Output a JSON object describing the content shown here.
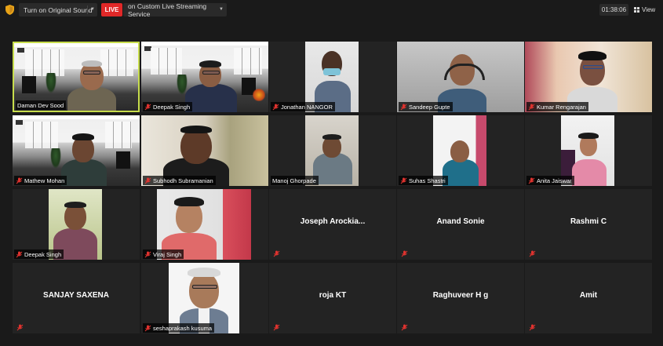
{
  "toolbar": {
    "sound_label": "Turn on Original Sound",
    "live_badge": "LIVE",
    "stream_label": "on Custom Live Streaming Service",
    "timer": "01:38:06",
    "view_label": "View"
  },
  "participants": [
    {
      "name": "Daman Dev Sood",
      "video": true,
      "active": true
    },
    {
      "name": "Deepak Singh",
      "video": true
    },
    {
      "name": "Jonathan NANGOR",
      "video": true
    },
    {
      "name": "Sandeep Gupte",
      "video": true
    },
    {
      "name": "Kumar Rengarajan",
      "video": true
    },
    {
      "name": "Mathew Mohan",
      "video": true
    },
    {
      "name": "Subhodh Subramanian",
      "video": true
    },
    {
      "name": "Manoj Ghorpade",
      "video": true
    },
    {
      "name": "Suhas Shastri",
      "video": true
    },
    {
      "name": "Anita Jaiswar",
      "video": true
    },
    {
      "name": "Deepak Singh",
      "video": true
    },
    {
      "name": "Viraj Singh",
      "video": true
    },
    {
      "name": "Joseph  Arockia...",
      "video": false
    },
    {
      "name": "Anand Sonie",
      "video": false
    },
    {
      "name": "Rashmi C",
      "video": false
    },
    {
      "name": "SANJAY SAXENA",
      "video": false
    },
    {
      "name": "seshaprakash kusuma",
      "video": true
    },
    {
      "name": "roja KT",
      "video": false
    },
    {
      "name": "Raghuveer H g",
      "video": false
    },
    {
      "name": "Amit",
      "video": false
    }
  ],
  "colors": {
    "background": "#1a1a1a",
    "tile": "#232323",
    "active_border": "#c7dd4c",
    "live_red": "#e02828",
    "mute_red": "#e0332f"
  }
}
